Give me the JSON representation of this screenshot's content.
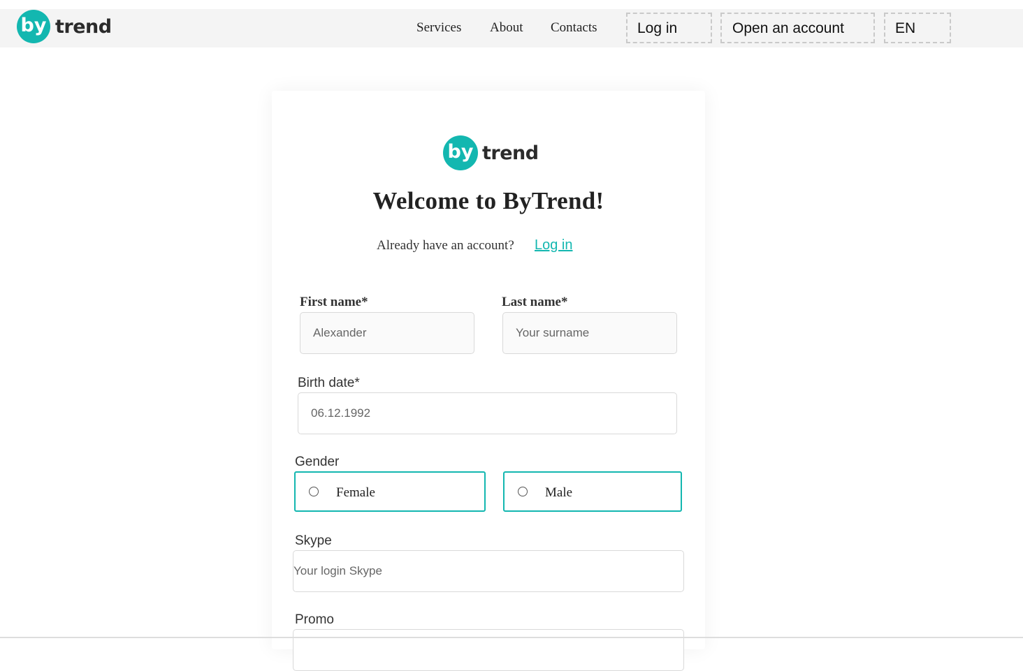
{
  "brand": {
    "logo_mark": "by",
    "logo_word": "trend",
    "accent_color": "#13b7b0"
  },
  "nav": {
    "links": [
      "Services",
      "About",
      "Contacts"
    ],
    "login_button": "Log in",
    "open_account_button": "Open an account",
    "language": "EN"
  },
  "form": {
    "title": "Welcome to ByTrend!",
    "already_text": "Already have an account?",
    "login_link": "Log in",
    "first_name": {
      "label": "First name*",
      "placeholder": "Alexander"
    },
    "last_name": {
      "label": "Last name*",
      "placeholder": "Your surname"
    },
    "birth_date": {
      "label": "Birth date*",
      "placeholder": "06.12.1992"
    },
    "gender": {
      "label": "Gender",
      "options": [
        "Female",
        "Male"
      ],
      "selected": ""
    },
    "skype": {
      "label": "Skype",
      "placeholder": "Your login Skype"
    },
    "promo": {
      "label": "Promo"
    }
  }
}
